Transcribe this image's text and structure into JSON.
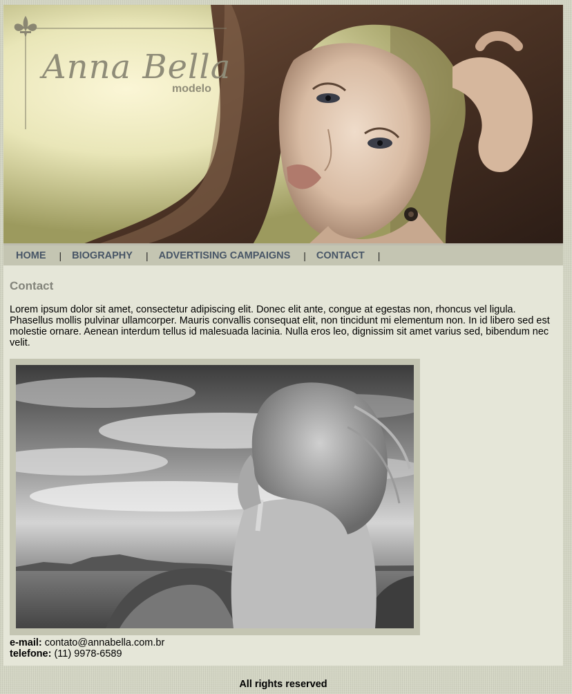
{
  "brand": {
    "name": "Anna Bella",
    "subtitle": "modelo"
  },
  "nav": {
    "items": [
      {
        "label": "HOME"
      },
      {
        "label": "BIOGRAPHY"
      },
      {
        "label": "ADVERTISING CAMPAIGNS"
      },
      {
        "label": "CONTACT"
      }
    ],
    "separator": "|"
  },
  "main": {
    "title": "Contact",
    "paragraph": "Lorem ipsum dolor sit amet, consectetur adipiscing elit. Donec elit ante, congue at egestas non, rhoncus vel ligula. Phasellus mollis pulvinar ullamcorper. Mauris convallis consequat elit, non tincidunt mi elementum non. In id libero sed est molestie ornare. Aenean interdum tellus id malesuada lacinia. Nulla eros leo, dignissim sit amet varius sed, bibendum nec velit.",
    "email_label": "e-mail:",
    "email_value": "contato@annabella.com.br",
    "phone_label": "telefone:",
    "phone_value": "(11) 9978-6589"
  },
  "footer": {
    "text": "All rights reserved"
  },
  "colors": {
    "page_bg": "#e5e6d8",
    "nav_bg": "#c4c5b2",
    "nav_text": "#475566",
    "title": "#82837a",
    "frame": "#c4c5b2"
  }
}
